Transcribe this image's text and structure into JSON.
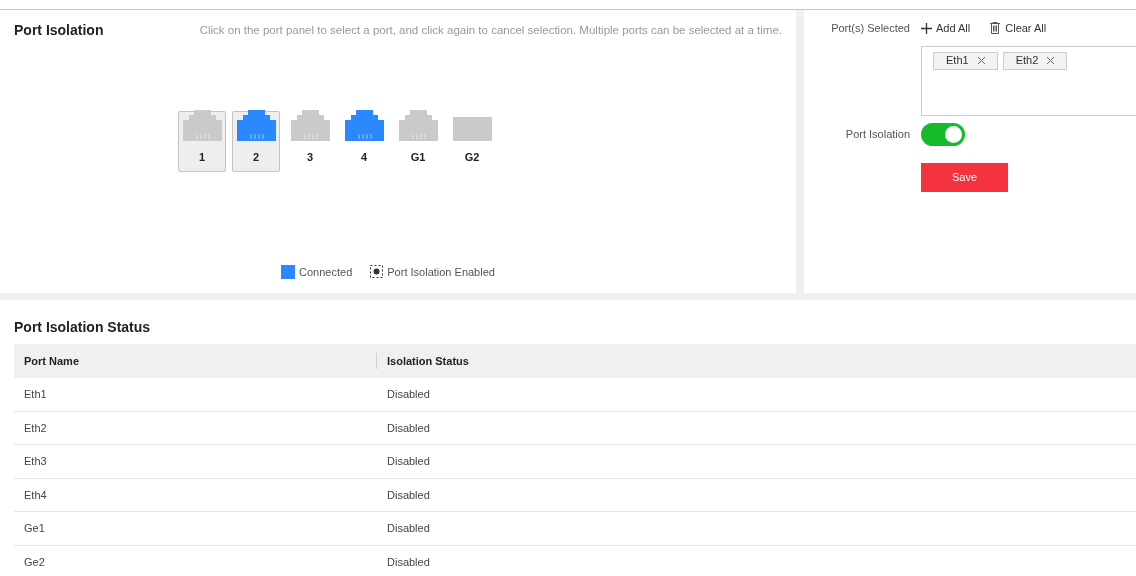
{
  "panel": {
    "title": "Port Isolation",
    "hint": "Click on the port panel to select a port, and click again to cancel selection. Multiple ports can be selected at a time.",
    "ports": [
      {
        "kind": "rj45",
        "label": "1",
        "connected": false,
        "selected": true
      },
      {
        "kind": "rj45",
        "label": "2",
        "connected": true,
        "selected": true
      },
      {
        "kind": "rj45",
        "label": "3",
        "connected": false,
        "selected": false
      },
      {
        "kind": "rj45",
        "label": "4",
        "connected": true,
        "selected": false
      },
      {
        "kind": "rj45",
        "label": "G1",
        "connected": false,
        "selected": false
      },
      {
        "kind": "sfp",
        "label": "G2",
        "connected": false,
        "selected": false
      }
    ],
    "legend": [
      "Connected",
      "Port Isolation Enabled"
    ]
  },
  "settings": {
    "selected_label": "Port(s) Selected",
    "add_all": "Add All",
    "clear_all": "Clear All",
    "tags": [
      "Eth1",
      "Eth2"
    ],
    "isolation_label": "Port Isolation",
    "isolation_on": true,
    "save": "Save"
  },
  "status": {
    "title": "Port Isolation Status",
    "columns": [
      "Port Name",
      "Isolation Status"
    ],
    "rows": [
      [
        "Eth1",
        "Disabled"
      ],
      [
        "Eth2",
        "Disabled"
      ],
      [
        "Eth3",
        "Disabled"
      ],
      [
        "Eth4",
        "Disabled"
      ],
      [
        "Ge1",
        "Disabled"
      ],
      [
        "Ge2",
        "Disabled"
      ]
    ]
  }
}
